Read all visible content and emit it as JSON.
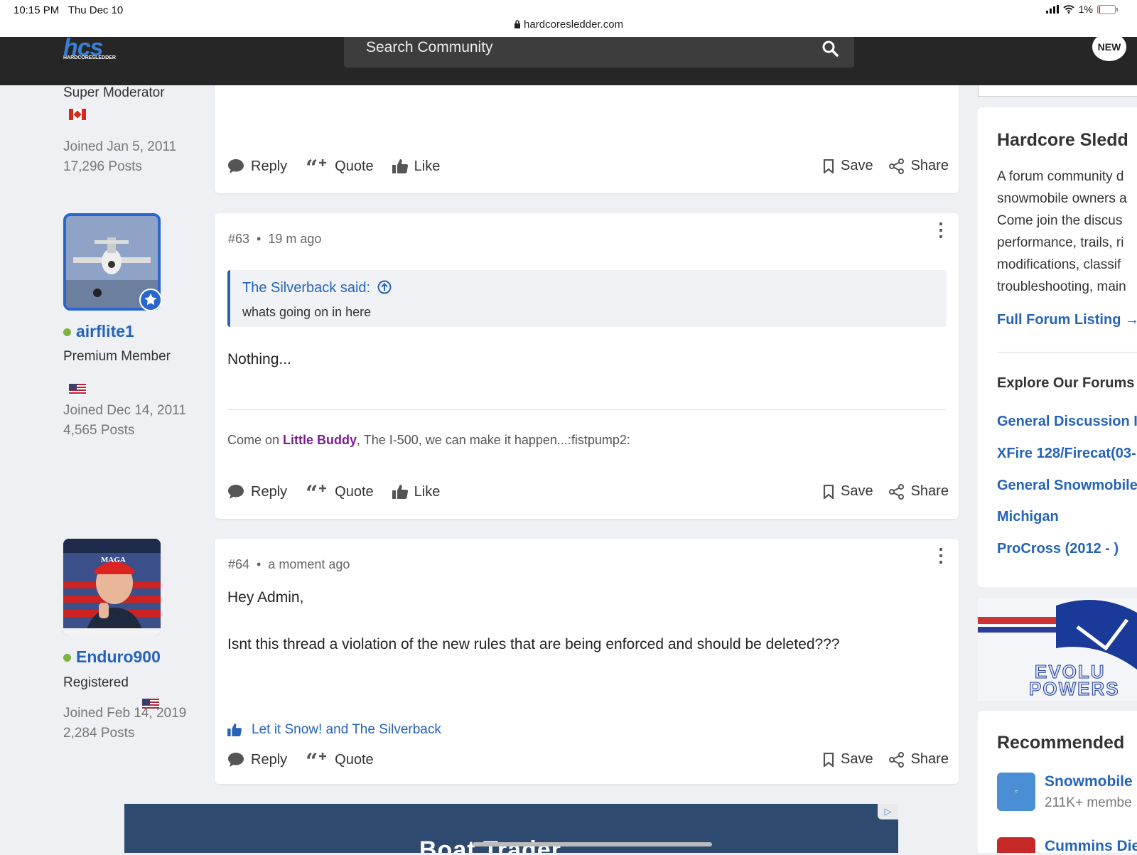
{
  "status_bar": {
    "time": "10:15 PM",
    "date": "Thu Dec 10",
    "url": "hardcoresledder.com",
    "battery": "1%"
  },
  "header": {
    "logo_main": "hcs",
    "logo_sub": "HARDCORESLEDDER",
    "search_placeholder": "Search Community",
    "new_badge": "NEW"
  },
  "actions": {
    "reply": "Reply",
    "quote": "Quote",
    "like": "Like",
    "save": "Save",
    "share": "Share"
  },
  "post62": {
    "role": "Super Moderator",
    "joined": "Joined Jan 5, 2011",
    "posts": "17,296 Posts"
  },
  "post63": {
    "username": "airflite1",
    "role": "Premium Member",
    "joined": "Joined Dec 14, 2011",
    "posts": "4,565 Posts",
    "number": "#63",
    "time": "19 m ago",
    "quote_author": "The Silverback said:",
    "quote_text": "whats going on in here",
    "body": "Nothing...",
    "sig_pre": "Come on ",
    "sig_bold": "Little Buddy",
    "sig_post": ", The I-500, we can make it happen...:fistpump2:"
  },
  "post64": {
    "username": "Enduro900",
    "role": "Registered",
    "joined": "Joined Feb 14, 2019",
    "posts": "2,284 Posts",
    "number": "#64",
    "time": "a moment ago",
    "line1": "Hey Admin,",
    "line2": "Isnt this thread a violation of the new rules that are being enforced and should be deleted???",
    "likes": "Let it Snow! and The Silverback",
    "avatar_cap": "MAGA"
  },
  "sidebar": {
    "title": "Hardcore Sledd",
    "desc": [
      "A forum community d",
      "snowmobile owners a",
      "Come join the discus",
      "performance, trails, ri",
      "modifications, classif",
      "troubleshooting, main"
    ],
    "full_listing": "Full Forum Listing →",
    "explore_title": "Explore Our Forums",
    "forums": [
      "General Discussion I",
      "XFire 128/Firecat(03-",
      "General Snowmobile",
      "Michigan",
      "ProCross (2012 - )"
    ],
    "ad_text": [
      "EVOLU",
      "POWERS"
    ],
    "recommended_title": "Recommended",
    "rec1_name": "Snowmobile",
    "rec1_sub": "211K+ membe",
    "rec2_name": "Cummins Die"
  },
  "bottom_ad": {
    "text": "Boat Trader"
  },
  "colors": {
    "accent": "#2563b8",
    "header_bg": "#262626",
    "online": "#7cb342"
  }
}
